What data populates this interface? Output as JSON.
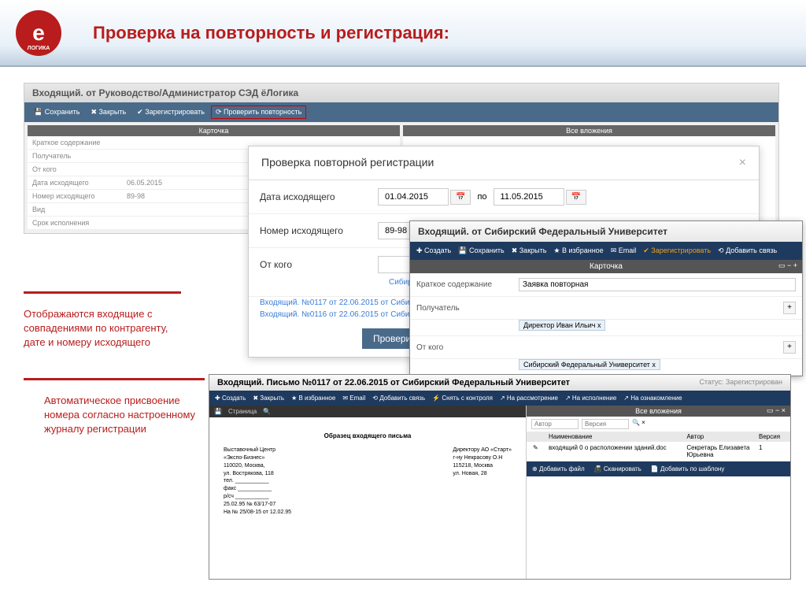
{
  "header": {
    "logo_letter": "е",
    "title": "Проверка на повторность и регистрация:"
  },
  "bg_window": {
    "title": "Входящий. от Руководство/Администратор СЭД ёЛогика",
    "toolbar": {
      "save": "Сохранить",
      "close": "Закрыть",
      "register": "Зарегистрировать",
      "check_dup": "Проверить повторность"
    },
    "panel_left": "Карточка",
    "panel_right": "Все вложения",
    "fields": {
      "summary": "Краткое содержание",
      "recipient": "Получатель",
      "from": "От кого",
      "out_date": "Дата исходящего",
      "out_date_val": "06.05.2015",
      "out_num": "Номер исходящего",
      "out_num_val": "89-98",
      "type": "Вид",
      "sum": "Срок исполнения"
    }
  },
  "callouts": {
    "c1": "Отображаются входящие с совпадениями по контрагенту, дате и номеру исходящего",
    "c2": "Автоматическое присвоение номера согласно настроенному журналу регистрации"
  },
  "modal": {
    "title": "Проверка повторной регистрации",
    "date_label": "Дата исходящего",
    "date_from": "01.04.2015",
    "date_sep": "по",
    "date_to": "11.05.2015",
    "num_label": "Номер исходящего",
    "num_value": "89-98",
    "from_label": "От кого",
    "from_hint": "Сибирский Федеральный Ун",
    "result1": "Входящий. №0117 от 22.06.2015 от Сибирский Федер",
    "result2": "Входящий. №0116 от 22.06.2015 от Сибирский Федер",
    "check_btn": "Проверить"
  },
  "card": {
    "title": "Входящий. от Сибирский Федеральный Университет",
    "toolbar": {
      "create": "Создать",
      "save": "Сохранить",
      "close": "Закрыть",
      "fav": "В избранное",
      "email": "Email",
      "register": "Зарегистрировать",
      "link": "Добавить связь"
    },
    "section": "Карточка",
    "summary_label": "Краткое содержание",
    "summary_value": "Заявка повторная",
    "recipient_label": "Получатель",
    "recipient_value": "Директор Иван Ильич х",
    "from_label": "От кого",
    "from_value": "Сибирский Федеральный Университет х"
  },
  "bottom": {
    "title": "Входящий. Письмо №0117 от 22.06.2015 от Сибирский Федеральный Университет",
    "status_label": "Статус:",
    "status_value": "Зарегистрирован",
    "toolbar": {
      "create": "Создать",
      "close": "Закрыть",
      "fav": "В избранное",
      "email": "Email",
      "link": "Добавить связь",
      "control": "Снять с контроля",
      "review": "На рассмотрение",
      "exec": "На исполнение",
      "agree": "На ознакомление"
    },
    "pdf": {
      "heading": "Образец входящего письма",
      "left": "Выставочный Центр\n«Экспо-Бизнес»\n110020, Москва,\nул. Вострякова, 118\nтел. ___________\nфакс ___________\nр/сч ___________\n25.02.95 № 63/17-07\nНа № 25/08-15 от 12.02.95",
      "right": "Директору АО «Старт»\nг-ну Некрасову О.Н\n115218, Москва\nул. Новая, 28"
    },
    "attach": {
      "section": "Все вложения",
      "filter_author": "Автор",
      "filter_version": "Версия",
      "col_name": "Наименование",
      "col_author": "Автор",
      "col_version": "Версия",
      "row_name": "входящий 0 о расположении зданий.doc",
      "row_author": "Секретарь Елизавета Юрьевна",
      "row_version": "1",
      "add_file": "Добавить файл",
      "scan": "Сканировать",
      "template": "Добавить по шаблону"
    }
  }
}
